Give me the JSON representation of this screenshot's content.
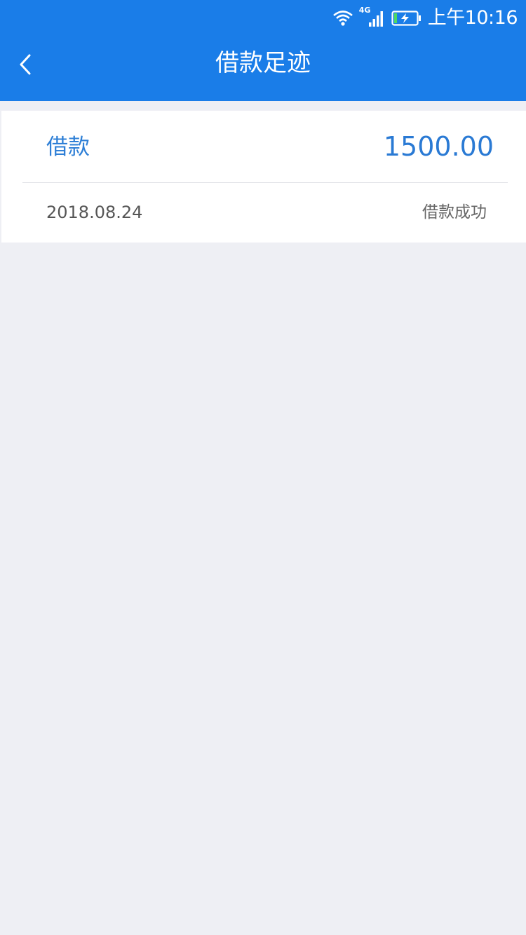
{
  "status_bar": {
    "time": "上午10:16",
    "network": "4G",
    "icons": [
      "wifi-icon",
      "cellular-signal-icon",
      "battery-charging-icon"
    ]
  },
  "nav": {
    "title": "借款足迹",
    "back_icon": "chevron-left-icon"
  },
  "records": [
    {
      "label": "借款",
      "amount": "1500.00",
      "date": "2018.08.24",
      "status": "借款成功"
    }
  ],
  "colors": {
    "header": "#1a7de8",
    "accent": "#2a7ad4",
    "background": "#eeeff4"
  }
}
